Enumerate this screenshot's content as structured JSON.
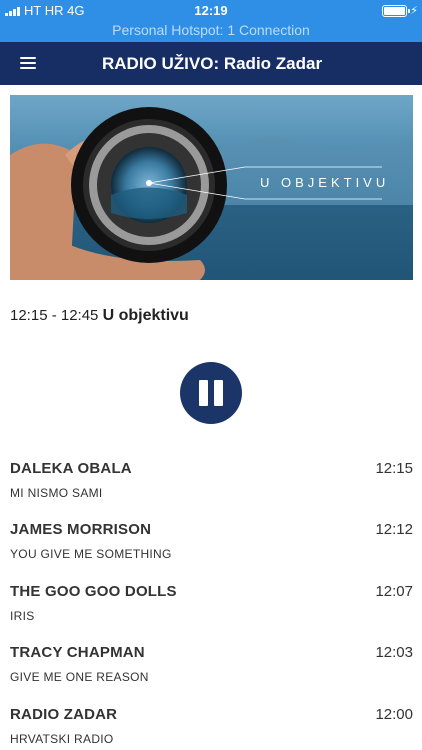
{
  "status_bar": {
    "carrier": "HT HR  4G",
    "time": "12:19",
    "hotspot": "Personal Hotspot: 1 Connection",
    "charging_symbol": "⚡"
  },
  "header": {
    "title": "RADIO UŽIVO: Radio Zadar"
  },
  "hero": {
    "caption": "U OBJEKTIVU"
  },
  "now_showing": {
    "time_range": "12:15 - 12:45",
    "name": "U objektivu"
  },
  "player": {
    "state": "playing",
    "button_color": "#1c3569"
  },
  "tracks": [
    {
      "artist": "DALEKA OBALA",
      "song": "MI NISMO SAMI",
      "time": "12:15"
    },
    {
      "artist": "JAMES MORRISON",
      "song": "YOU GIVE ME SOMETHING",
      "time": "12:12"
    },
    {
      "artist": "THE GOO GOO DOLLS",
      "song": "IRIS",
      "time": "12:07"
    },
    {
      "artist": "TRACY CHAPMAN",
      "song": "GIVE ME ONE REASON",
      "time": "12:03"
    },
    {
      "artist": "RADIO ZADAR",
      "song": "HRVATSKI RADIO",
      "time": "12:00"
    }
  ],
  "colors": {
    "status_bar": "#2f8fe6",
    "header": "#162e63",
    "accent": "#1c3569"
  }
}
